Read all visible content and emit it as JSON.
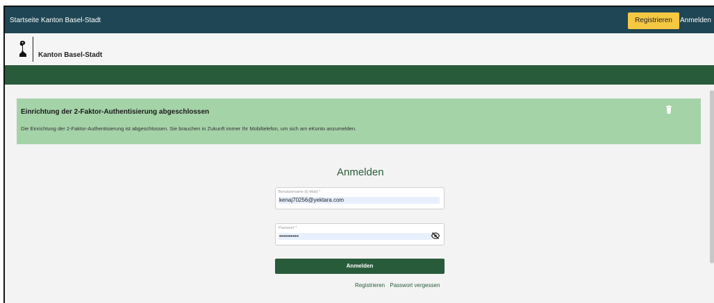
{
  "topbar": {
    "home_link": "Startseite Kanton Basel-Stadt",
    "register_button": "Registrieren",
    "login_link": "Anmelden"
  },
  "brand": {
    "name": "Kanton Basel-Stadt"
  },
  "alert": {
    "title": "Einrichtung der 2-Faktor-Authentisierung abgeschlossen",
    "message": "Die Einrichtung der 2-Faktor-Authentisierung ist abgeschlossen. Sie brauchen in Zukunft immer Ihr Mobiltelefon, um sich am eKonto anzumelden.",
    "dismiss_icon": "trash-icon"
  },
  "login_form": {
    "title": "Anmelden",
    "username_label": "Benutzername (E-Mail) *",
    "username_value": "kenaj70256@yektara.com",
    "password_label": "Passwort *",
    "password_value": "••••••••••",
    "visibility_icon": "eye-off-icon",
    "submit_label": "Anmelden",
    "register_link": "Registrieren",
    "forgot_link": "Passwort vergessen"
  },
  "colors": {
    "topbar": "#1f4654",
    "brand_green": "#285b3a",
    "alert_bg": "#a5d3a8",
    "register_yellow": "#f5c842"
  }
}
